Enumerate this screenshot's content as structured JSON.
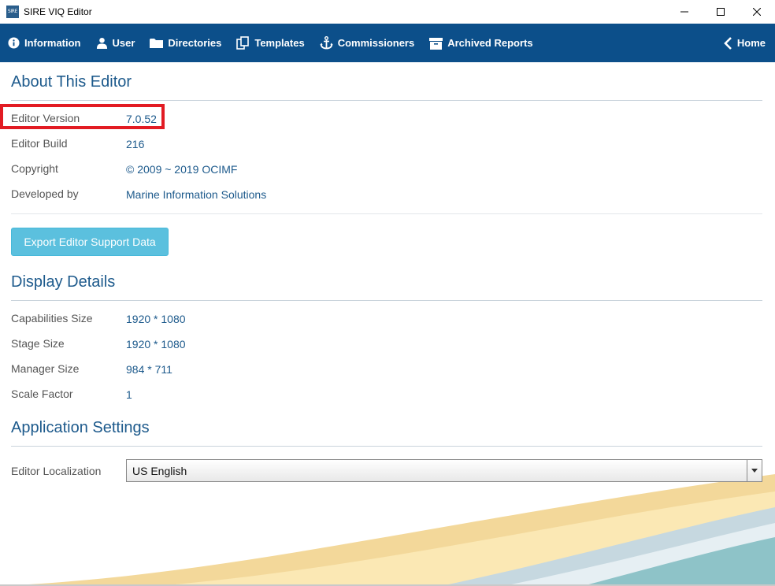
{
  "window": {
    "icon_text": "SIRE",
    "title": "SIRE VIQ Editor"
  },
  "nav": {
    "items": [
      {
        "label": "Information",
        "icon": "info-icon"
      },
      {
        "label": "User",
        "icon": "user-icon"
      },
      {
        "label": "Directories",
        "icon": "folder-icon"
      },
      {
        "label": "Templates",
        "icon": "templates-icon"
      },
      {
        "label": "Commissioners",
        "icon": "anchor-icon"
      },
      {
        "label": "Archived Reports",
        "icon": "archive-icon"
      }
    ],
    "home": {
      "label": "Home",
      "icon": "chevron-left-icon"
    }
  },
  "about": {
    "title": "About This Editor",
    "rows": [
      {
        "label": "Editor Version",
        "value": "7.0.52"
      },
      {
        "label": "Editor Build",
        "value": "216"
      },
      {
        "label": "Copyright",
        "value": "© 2009 ~ 2019 OCIMF"
      },
      {
        "label": "Developed by",
        "value": "Marine Information Solutions"
      }
    ],
    "export_button": "Export Editor Support Data"
  },
  "display": {
    "title": "Display Details",
    "rows": [
      {
        "label": "Capabilities Size",
        "value": "1920 * 1080"
      },
      {
        "label": "Stage Size",
        "value": "1920 * 1080"
      },
      {
        "label": "Manager Size",
        "value": "984 * 711"
      },
      {
        "label": "Scale Factor",
        "value": "1"
      }
    ]
  },
  "settings": {
    "title": "Application Settings",
    "localization_label": "Editor Localization",
    "localization_value": "US English"
  },
  "colors": {
    "navbar": "#0c4f8a",
    "accent": "#1d5a8c",
    "button": "#5bc0de",
    "highlight": "#e21b23"
  }
}
